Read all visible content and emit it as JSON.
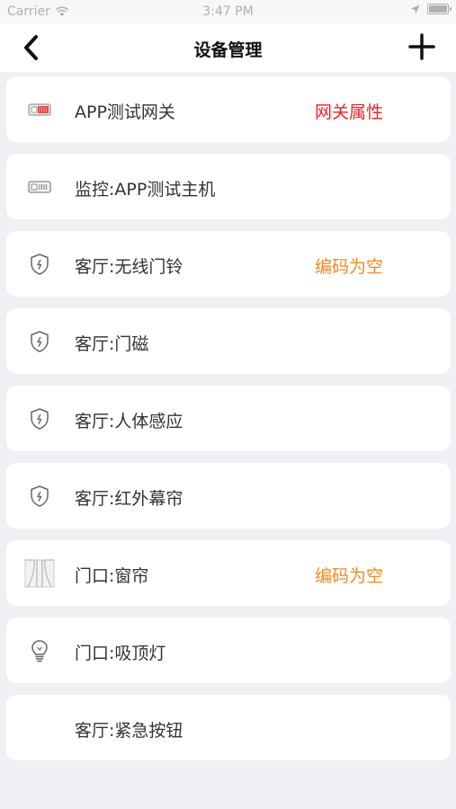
{
  "status_bar": {
    "carrier": "Carrier",
    "time": "3:47 PM"
  },
  "nav": {
    "title": "设备管理"
  },
  "devices": [
    {
      "label": "APP测试网关",
      "icon": "gateway-icon",
      "action": "网关属性",
      "action_color": "#ee2222"
    },
    {
      "label": "监控:APP测试主机",
      "icon": "host-device-icon"
    },
    {
      "label": "客厅:无线门铃",
      "icon": "security-shield-icon",
      "action": "编码为空",
      "action_color": "#f08a24"
    },
    {
      "label": "客厅:门磁",
      "icon": "security-shield-icon"
    },
    {
      "label": "客厅:人体感应",
      "icon": "security-shield-icon"
    },
    {
      "label": "客厅:红外幕帘",
      "icon": "security-shield-icon"
    },
    {
      "label": "门口:窗帘",
      "icon": "curtain-icon",
      "action": "编码为空",
      "action_color": "#f08a24"
    },
    {
      "label": "门口:吸顶灯",
      "icon": "light-bulb-icon"
    },
    {
      "label": "客厅:紧急按钮",
      "icon": ""
    }
  ]
}
